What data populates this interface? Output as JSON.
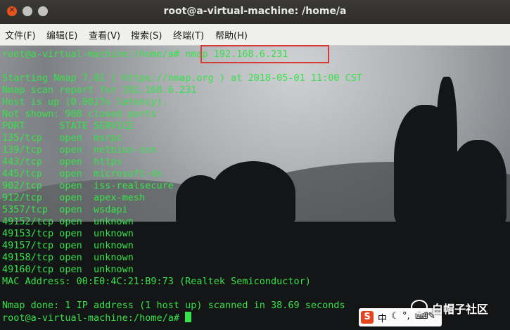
{
  "window": {
    "title": "root@a-virtual-machine: /home/a"
  },
  "menu": [
    "文件(F)",
    "编辑(E)",
    "查看(V)",
    "搜索(S)",
    "终端(T)",
    "帮助(H)"
  ],
  "terminal": {
    "command_prompt": "root@a-virtual-machine:/home/a# ",
    "command": "nmap 192.168.6.231",
    "output": [
      "",
      "Starting Nmap 7.01 ( https://nmap.org ) at 2018-05-01 11:00 CST",
      "Nmap scan report for 192.168.6.231",
      "Host is up (0.0017s latency).",
      "Not shown: 988 closed ports",
      "PORT      STATE SERVICE",
      "135/tcp   open  msrpc",
      "139/tcp   open  netbios-ssn",
      "443/tcp   open  https",
      "445/tcp   open  microsoft-ds",
      "902/tcp   open  iss-realsecure",
      "912/tcp   open  apex-mesh",
      "5357/tcp  open  wsdapi",
      "49152/tcp open  unknown",
      "49153/tcp open  unknown",
      "49157/tcp open  unknown",
      "49158/tcp open  unknown",
      "49160/tcp open  unknown",
      "MAC Address: 00:E0:4C:21:B9:73 (Realtek Semiconductor)",
      "",
      "Nmap done: 1 IP address (1 host up) scanned in 38.69 seconds"
    ],
    "final_prompt": "root@a-virtual-machine:/home/a# "
  },
  "ime": {
    "logo": "S",
    "mode": "中"
  },
  "watermark": {
    "text": "白帽子社区"
  },
  "colors": {
    "terminal_text": "#35e24a",
    "highlight_border": "#d83a3a",
    "close_button": "#e95420"
  }
}
